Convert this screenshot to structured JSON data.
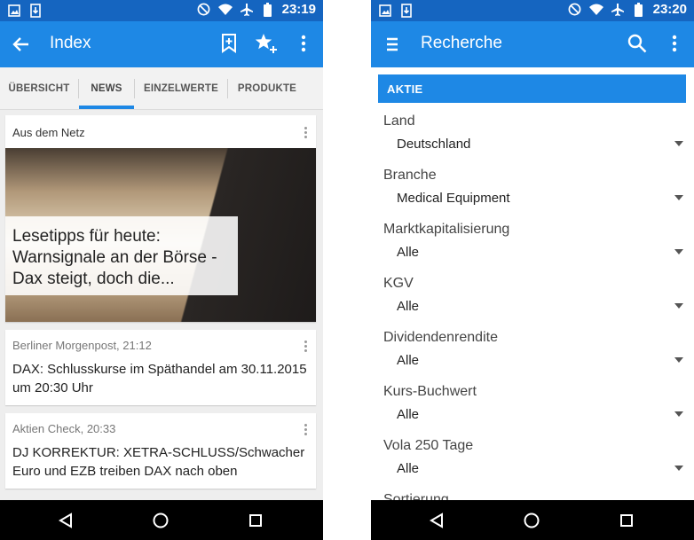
{
  "colors": {
    "status_bar": "#1565c0",
    "app_bar": "#1e88e5",
    "accent": "#1e88e5"
  },
  "left": {
    "status": {
      "time": "23:19",
      "icons": [
        "image-icon",
        "download-icon",
        "blocked-icon",
        "wifi-icon",
        "airplane-icon",
        "battery-icon"
      ]
    },
    "appbar": {
      "title": "Index",
      "actions": [
        "bookmark-add-icon",
        "star-add-icon",
        "overflow-menu-icon"
      ]
    },
    "tabs": [
      "ÜBERSICHT",
      "NEWS",
      "EINZELWERTE",
      "PRODUKTE"
    ],
    "active_tab": "NEWS",
    "cards": [
      {
        "source": "Aus dem Netz",
        "headline": "Lesetipps für heute: Warnsignale an der Börse - Dax steigt, doch die..."
      },
      {
        "source": "Berliner Morgenpost, 21:12",
        "headline": "DAX: Schlusskurse im Späthandel am 30.11.2015 um 20:30 Uhr"
      },
      {
        "source": "Aktien Check, 20:33",
        "headline": "DJ KORREKTUR: XETRA-SCHLUSS/Schwacher Euro und EZB treiben DAX nach oben"
      }
    ]
  },
  "right": {
    "status": {
      "time": "23:20",
      "icons": [
        "image-icon",
        "download-icon",
        "blocked-icon",
        "wifi-icon",
        "airplane-icon",
        "battery-icon"
      ]
    },
    "appbar": {
      "title": "Recherche",
      "actions": [
        "search-icon",
        "overflow-menu-icon"
      ]
    },
    "section": "AKTIE",
    "fields": [
      {
        "label": "Land",
        "value": "Deutschland"
      },
      {
        "label": "Branche",
        "value": "Medical Equipment"
      },
      {
        "label": "Marktkapitalisierung",
        "value": "Alle"
      },
      {
        "label": "KGV",
        "value": "Alle"
      },
      {
        "label": "Dividendenrendite",
        "value": "Alle"
      },
      {
        "label": "Kurs-Buchwert",
        "value": "Alle"
      },
      {
        "label": "Vola 250 Tage",
        "value": "Alle"
      },
      {
        "label": "Sortierung",
        "value": ""
      }
    ]
  },
  "navbar": [
    "back-icon",
    "home-icon",
    "recents-icon"
  ]
}
